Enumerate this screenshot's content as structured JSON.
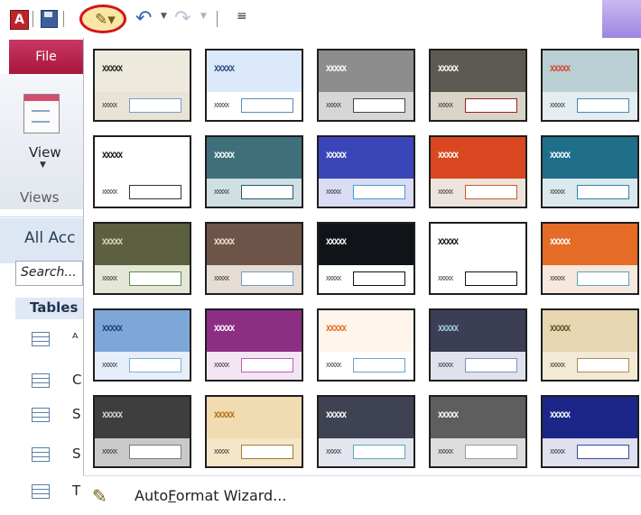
{
  "qat": {
    "app_icon_letter": "A",
    "autoformat_icon": "autoformat-wand-icon",
    "undo_icon": "undo-icon",
    "redo_icon": "redo-icon",
    "customize_icon": "customize-toolbar-icon"
  },
  "ribbon": {
    "file_label": "File",
    "view_label": "View",
    "views_group_label": "Views"
  },
  "nav": {
    "title": "All Acc",
    "search_placeholder": "Search...",
    "group_label": "Tables",
    "items": [
      {
        "label": "ᴬ"
      },
      {
        "label": "C"
      },
      {
        "label": "S"
      },
      {
        "label": "S"
      },
      {
        "label": "T"
      }
    ]
  },
  "gallery": {
    "sample_title": "XXXXX",
    "sample_label": "XXXXX",
    "footer_label_pre": "Auto",
    "footer_label_access": "F",
    "footer_label_post": "ormat Wizard...",
    "styles": [
      {
        "name": "style-1",
        "head": "#ede9dc",
        "body": "#e8e3d4",
        "title": "#222",
        "box": "#7a9cc6"
      },
      {
        "name": "style-2",
        "head": "#dce9fa",
        "body": "#ffffff",
        "title": "#2b4a7a",
        "box": "#5b88c4"
      },
      {
        "name": "style-3",
        "head": "#8d8d8d",
        "body": "#d6d6d6",
        "title": "#ffffff",
        "box": "#444444"
      },
      {
        "name": "style-4",
        "head": "#5d5a53",
        "body": "#d9d4c8",
        "title": "#ffffff",
        "box": "#9b1f22"
      },
      {
        "name": "style-5",
        "head": "#b9cfd4",
        "body": "#e4edf0",
        "title": "#d0452b",
        "box": "#4a86b7"
      },
      {
        "name": "style-6",
        "head": "#ffffff",
        "body": "#ffffff",
        "title": "#111",
        "box": "#333333"
      },
      {
        "name": "style-7",
        "head": "#3e6f7a",
        "body": "#cfdfe2",
        "title": "#ffffff",
        "box": "#2f5a66"
      },
      {
        "name": "style-8",
        "head": "#3a46b8",
        "body": "#d9dcf3",
        "title": "#ffffff",
        "box": "#3fa2c9"
      },
      {
        "name": "style-9",
        "head": "#d8471f",
        "body": "#ece4dc",
        "title": "#ffffff",
        "box": "#c95a2a"
      },
      {
        "name": "style-10",
        "head": "#1f6f8a",
        "body": "#dbe9ee",
        "title": "#ffffff",
        "box": "#2f86b0"
      },
      {
        "name": "style-11",
        "head": "#5c6040",
        "body": "#e4e6d6",
        "title": "#d9dcb0",
        "box": "#5a8c46"
      },
      {
        "name": "style-12",
        "head": "#6d5448",
        "body": "#e5ddd5",
        "title": "#f1e3c9",
        "box": "#6a9cc8"
      },
      {
        "name": "style-13",
        "head": "#101418",
        "body": "#ffffff",
        "title": "#ffffff",
        "box": "#111111"
      },
      {
        "name": "style-14",
        "head": "#ffffff",
        "body": "#ffffff",
        "title": "#111",
        "box": "#111111"
      },
      {
        "name": "style-15",
        "head": "#e46c26",
        "body": "#f6e8dc",
        "title": "#ffffff",
        "box": "#5aa7b8"
      },
      {
        "name": "style-16",
        "head": "#7fa6d8",
        "body": "#e6eef9",
        "title": "#1f3f7a",
        "box": "#7cb2d6"
      },
      {
        "name": "style-17",
        "head": "#8c2e84",
        "body": "#f3e6f2",
        "title": "#ffffff",
        "box": "#c05bb3"
      },
      {
        "name": "style-18",
        "head": "#fff5ec",
        "body": "#ffffff",
        "title": "#e16a1f",
        "box": "#6aa1c7"
      },
      {
        "name": "style-19",
        "head": "#3b3e55",
        "body": "#dfe2ec",
        "title": "#9fd5e4",
        "box": "#7b93c1"
      },
      {
        "name": "style-20",
        "head": "#e6d6b2",
        "body": "#f3ead6",
        "title": "#6a4a1a",
        "box": "#a88a54"
      },
      {
        "name": "style-21",
        "head": "#3e3e3e",
        "body": "#c9c9c9",
        "title": "#d8d8d8",
        "box": "#7a7a7a"
      },
      {
        "name": "style-22",
        "head": "#f1dcb1",
        "body": "#f4e6c7",
        "title": "#b06d1a",
        "box": "#a47a38"
      },
      {
        "name": "style-23",
        "head": "#3f4252",
        "body": "#e3e6ee",
        "title": "#ffffff",
        "box": "#58a9b9"
      },
      {
        "name": "style-24",
        "head": "#5e5e5e",
        "body": "#dcdcdc",
        "title": "#ffffff",
        "box": "#9a9a9a"
      },
      {
        "name": "style-25",
        "head": "#1b2688",
        "body": "#dfe1ee",
        "title": "#ffffff",
        "box": "#3a4a9a"
      }
    ]
  }
}
